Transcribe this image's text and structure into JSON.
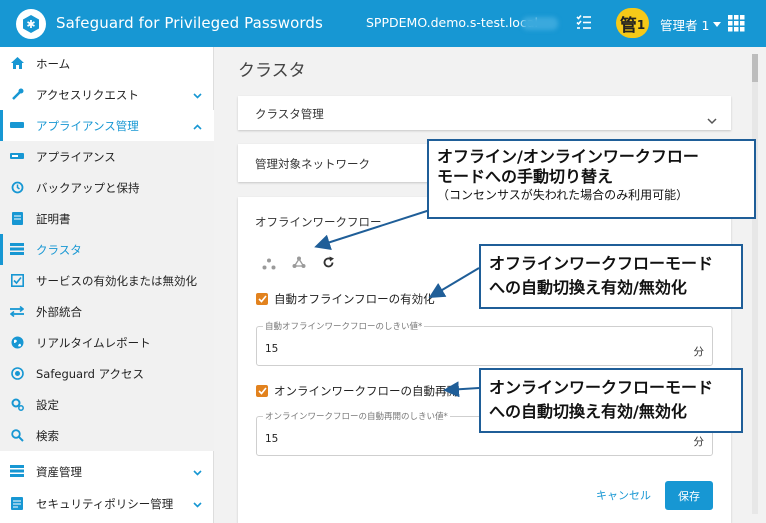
{
  "header": {
    "app_title": "Safeguard for Privileged Passwords",
    "host": "SPPDEMO.demo.s-test.local",
    "badge_char": "管",
    "badge_num": "1",
    "user_name": "管理者 1"
  },
  "sidebar": {
    "items": [
      {
        "label": "ホーム"
      },
      {
        "label": "アクセスリクエスト"
      },
      {
        "label": "アプライアンス管理"
      },
      {
        "label": "アプライアンス"
      },
      {
        "label": "バックアップと保持"
      },
      {
        "label": "証明書"
      },
      {
        "label": "クラスタ"
      },
      {
        "label": "サービスの有効化または無効化"
      },
      {
        "label": "外部統合"
      },
      {
        "label": "リアルタイムレポート"
      },
      {
        "label": "Safeguard アクセス"
      },
      {
        "label": "設定"
      },
      {
        "label": "検索"
      },
      {
        "label": "資産管理"
      },
      {
        "label": "セキュリティポリシー管理"
      }
    ]
  },
  "main": {
    "page_title": "クラスタ",
    "panels": {
      "cluster_mgmt": "クラスタ管理",
      "managed_network": "管理対象ネットワーク",
      "offline_workflow": "オフラインワークフロー"
    },
    "auto_offline": {
      "label": "自動オフラインフローの有効化",
      "field_label": "自動オフラインワークフローのしきい値*",
      "value": "15",
      "unit": "分"
    },
    "online_resume": {
      "label": "オンラインワークフローの自動再開",
      "field_label": "オンラインワークフローの自動再開のしきい値*",
      "value": "15",
      "unit": "分"
    },
    "cancel_label": "キャンセル",
    "save_label": "保存"
  },
  "callouts": {
    "c1_line1": "オフライン/オンラインワークフロー",
    "c1_line2": "モードへの手動切り替え",
    "c1_note": "（コンセンサスが失われた場合のみ利用可能）",
    "c2_line1": "オフラインワークフローモード",
    "c2_line2": "への自動切換え有効/無効化",
    "c3_line1": "オンラインワークフローモード",
    "c3_line2": "への自動切換え有効/無効化"
  },
  "colors": {
    "accent": "#1797d3",
    "badge": "#f5c918",
    "checkbox": "#e2821e",
    "callout_border": "#1f5e98"
  }
}
